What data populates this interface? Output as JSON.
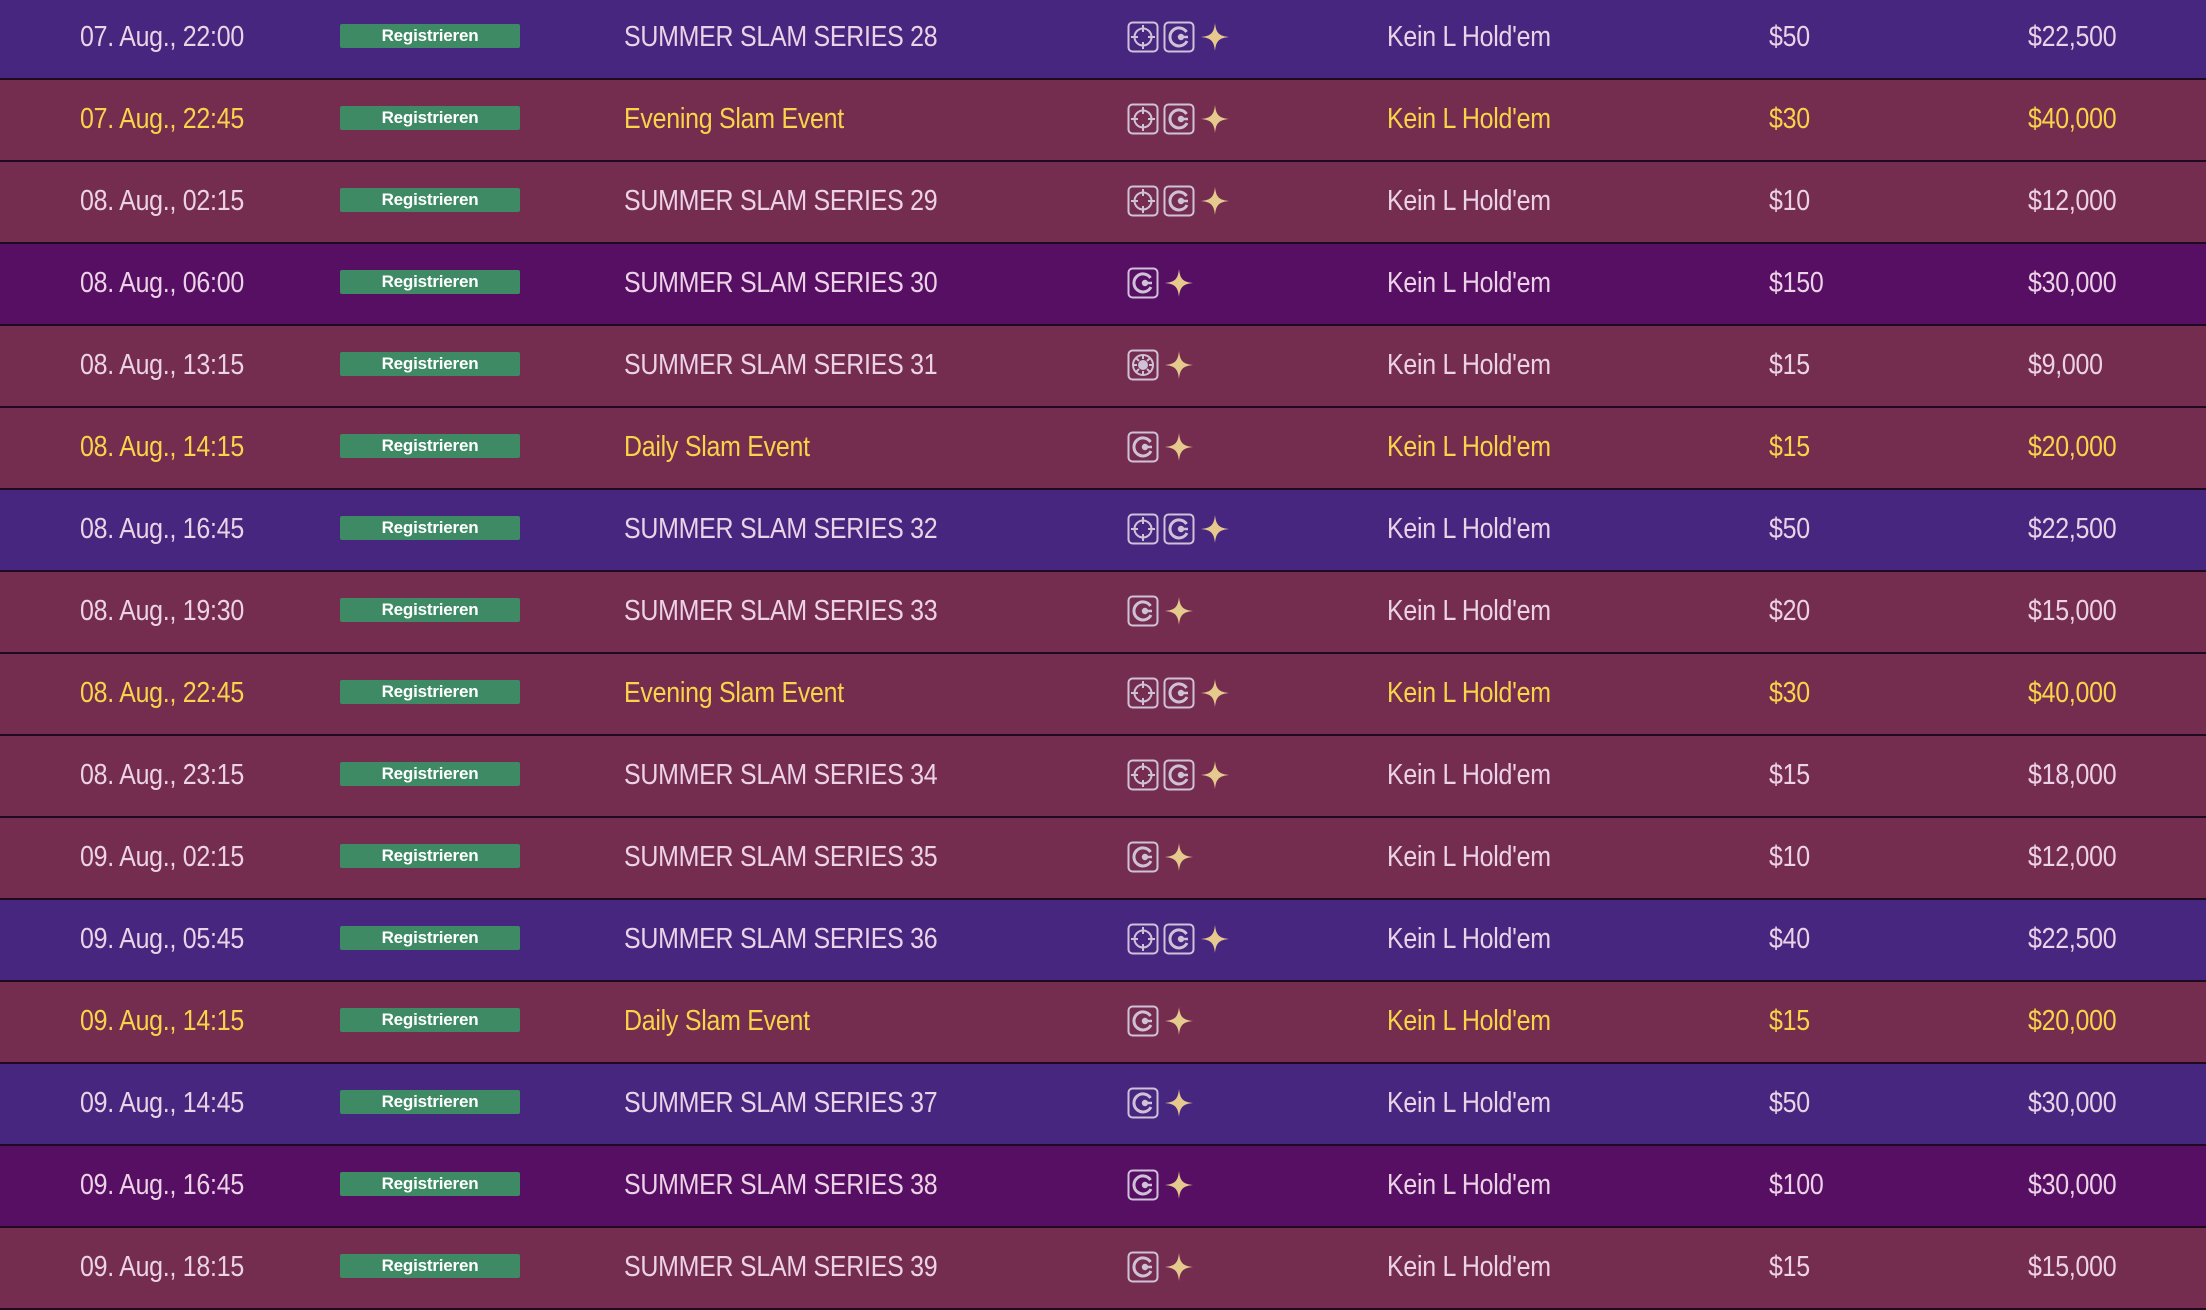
{
  "register_label": "Registrieren",
  "colors": {
    "purple": "#46267f",
    "maroon": "#752d4f",
    "violet": "#560f63",
    "highlight_text": "#f7d44a",
    "normal_text": "#ecd2e6",
    "register_button": "#3e8a64",
    "icon_border": "#cfc2d8",
    "star": "#e6c98d"
  },
  "tournaments": [
    {
      "date": "07. Aug., 22:00",
      "name": "SUMMER SLAM SERIES 28",
      "icons": [
        "bounty-icon",
        "replay-icon",
        "star-icon"
      ],
      "game": "Kein L Hold'em",
      "buyin": "$50",
      "prize": "$22,500",
      "bg": "purple",
      "highlight": false
    },
    {
      "date": "07. Aug., 22:45",
      "name": "Evening Slam Event",
      "icons": [
        "bounty-icon",
        "replay-icon",
        "star-icon"
      ],
      "game": "Kein L Hold'em",
      "buyin": "$30",
      "prize": "$40,000",
      "bg": "maroon",
      "highlight": true
    },
    {
      "date": "08. Aug., 02:15",
      "name": "SUMMER SLAM SERIES 29",
      "icons": [
        "bounty-icon",
        "replay-icon",
        "star-icon"
      ],
      "game": "Kein L Hold'em",
      "buyin": "$10",
      "prize": "$12,000",
      "bg": "maroon",
      "highlight": false
    },
    {
      "date": "08. Aug., 06:00",
      "name": "SUMMER SLAM SERIES 30",
      "icons": [
        "replay-icon",
        "star-icon"
      ],
      "game": "Kein L Hold'em",
      "buyin": "$150",
      "prize": "$30,000",
      "bg": "violet",
      "highlight": false
    },
    {
      "date": "08. Aug., 13:15",
      "name": "SUMMER SLAM SERIES 31",
      "icons": [
        "chip-icon",
        "star-icon"
      ],
      "game": "Kein L Hold'em",
      "buyin": "$15",
      "prize": "$9,000",
      "bg": "maroon",
      "highlight": false
    },
    {
      "date": "08. Aug., 14:15",
      "name": "Daily Slam Event",
      "icons": [
        "replay-icon",
        "star-icon"
      ],
      "game": "Kein L Hold'em",
      "buyin": "$15",
      "prize": "$20,000",
      "bg": "maroon",
      "highlight": true
    },
    {
      "date": "08. Aug., 16:45",
      "name": "SUMMER SLAM SERIES 32",
      "icons": [
        "bounty-icon",
        "replay-icon",
        "star-icon"
      ],
      "game": "Kein L Hold'em",
      "buyin": "$50",
      "prize": "$22,500",
      "bg": "purple",
      "highlight": false
    },
    {
      "date": "08. Aug., 19:30",
      "name": "SUMMER SLAM SERIES 33",
      "icons": [
        "replay-icon",
        "star-icon"
      ],
      "game": "Kein L Hold'em",
      "buyin": "$20",
      "prize": "$15,000",
      "bg": "maroon",
      "highlight": false
    },
    {
      "date": "08. Aug., 22:45",
      "name": "Evening Slam Event",
      "icons": [
        "bounty-icon",
        "replay-icon",
        "star-icon"
      ],
      "game": "Kein L Hold'em",
      "buyin": "$30",
      "prize": "$40,000",
      "bg": "maroon",
      "highlight": true
    },
    {
      "date": "08. Aug., 23:15",
      "name": "SUMMER SLAM SERIES 34",
      "icons": [
        "bounty-icon",
        "replay-icon",
        "star-icon"
      ],
      "game": "Kein L Hold'em",
      "buyin": "$15",
      "prize": "$18,000",
      "bg": "maroon",
      "highlight": false
    },
    {
      "date": "09. Aug., 02:15",
      "name": "SUMMER SLAM SERIES 35",
      "icons": [
        "replay-icon",
        "star-icon"
      ],
      "game": "Kein L Hold'em",
      "buyin": "$10",
      "prize": "$12,000",
      "bg": "maroon",
      "highlight": false
    },
    {
      "date": "09. Aug., 05:45",
      "name": "SUMMER SLAM SERIES 36",
      "icons": [
        "bounty-icon",
        "replay-icon",
        "star-icon"
      ],
      "game": "Kein L Hold'em",
      "buyin": "$40",
      "prize": "$22,500",
      "bg": "purple",
      "highlight": false
    },
    {
      "date": "09. Aug., 14:15",
      "name": "Daily Slam Event",
      "icons": [
        "replay-icon",
        "star-icon"
      ],
      "game": "Kein L Hold'em",
      "buyin": "$15",
      "prize": "$20,000",
      "bg": "maroon",
      "highlight": true
    },
    {
      "date": "09. Aug., 14:45",
      "name": "SUMMER SLAM SERIES 37",
      "icons": [
        "replay-icon",
        "star-icon"
      ],
      "game": "Kein L Hold'em",
      "buyin": "$50",
      "prize": "$30,000",
      "bg": "purple",
      "highlight": false
    },
    {
      "date": "09. Aug., 16:45",
      "name": "SUMMER SLAM SERIES 38",
      "icons": [
        "replay-icon",
        "star-icon"
      ],
      "game": "Kein L Hold'em",
      "buyin": "$100",
      "prize": "$30,000",
      "bg": "violet",
      "highlight": false
    },
    {
      "date": "09. Aug., 18:15",
      "name": "SUMMER SLAM SERIES 39",
      "icons": [
        "replay-icon",
        "star-icon"
      ],
      "game": "Kein L Hold'em",
      "buyin": "$15",
      "prize": "$15,000",
      "bg": "maroon",
      "highlight": false
    }
  ]
}
